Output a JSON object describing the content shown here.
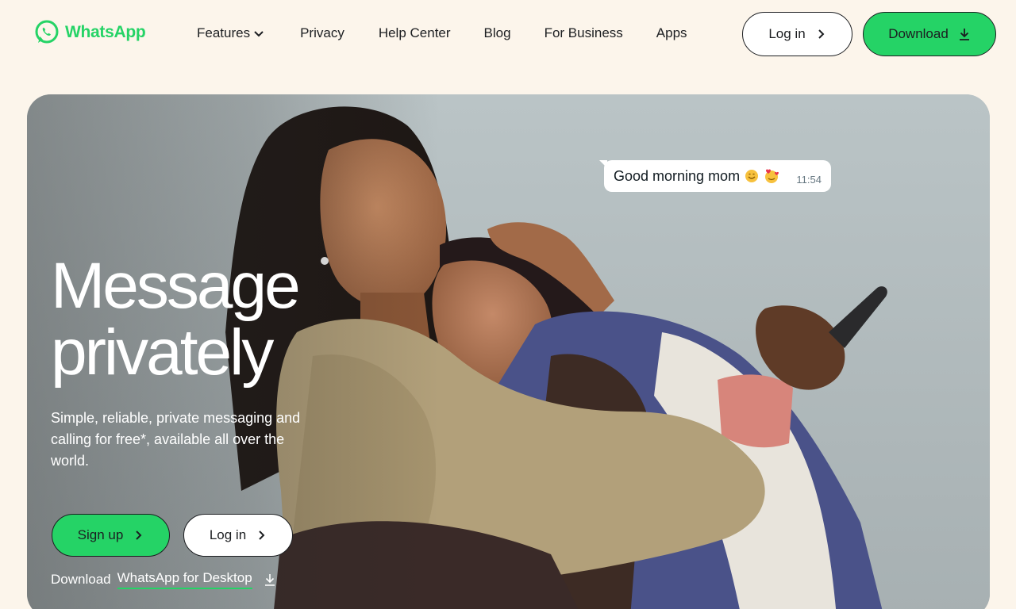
{
  "brand": {
    "name": "WhatsApp",
    "accent": "#25d366",
    "background": "#fcf5eb"
  },
  "nav": {
    "links": [
      {
        "label": "Features",
        "has_dropdown": true
      },
      {
        "label": "Privacy"
      },
      {
        "label": "Help Center"
      },
      {
        "label": "Blog"
      },
      {
        "label": "For Business"
      },
      {
        "label": "Apps"
      }
    ],
    "login_label": "Log in",
    "download_label": "Download"
  },
  "hero": {
    "chat_message": "Good morning mom",
    "chat_emojis": [
      "smiling-face-icon",
      "face-with-hearts-icon"
    ],
    "chat_time": "11:54",
    "title_line1": "Message",
    "title_line2": "privately",
    "subtitle": "Simple, reliable, private messaging and calling for free*, available all over the world.",
    "signup_label": "Sign up",
    "login_label": "Log in",
    "desktop_prefix": "Download",
    "desktop_link": "WhatsApp for Desktop"
  }
}
